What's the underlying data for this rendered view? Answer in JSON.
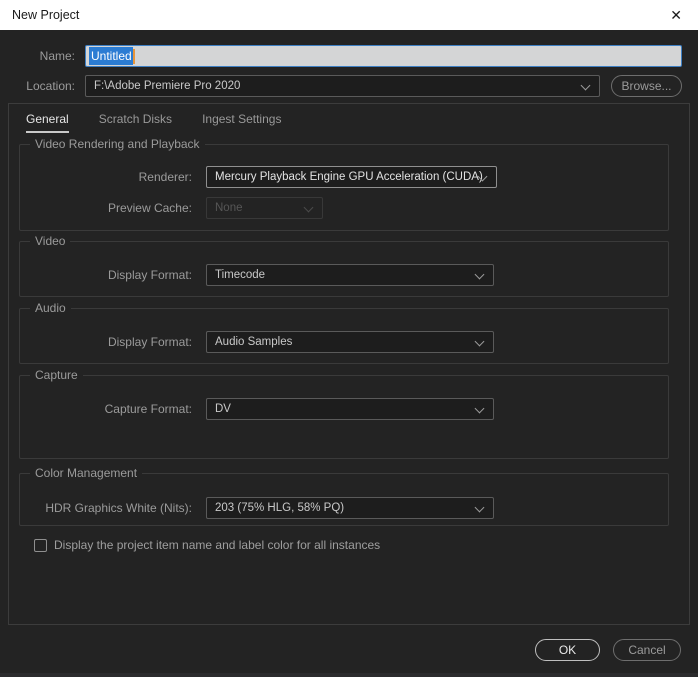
{
  "window": {
    "title": "New Project",
    "close_icon": "✕"
  },
  "fields": {
    "name": {
      "label": "Name:",
      "value": "Untitled"
    },
    "location": {
      "label": "Location:",
      "value": "F:\\Adobe Premiere Pro 2020",
      "browse_label": "Browse..."
    }
  },
  "tabs": [
    {
      "label": "General",
      "active": true
    },
    {
      "label": "Scratch Disks",
      "active": false
    },
    {
      "label": "Ingest Settings",
      "active": false
    }
  ],
  "groups": {
    "video_rendering": {
      "legend": "Video Rendering and Playback",
      "renderer": {
        "label": "Renderer:",
        "value": "Mercury Playback Engine GPU Acceleration (CUDA)"
      },
      "preview_cache": {
        "label": "Preview Cache:",
        "value": "None",
        "disabled": true
      }
    },
    "video": {
      "legend": "Video",
      "display_format": {
        "label": "Display Format:",
        "value": "Timecode"
      }
    },
    "audio": {
      "legend": "Audio",
      "display_format": {
        "label": "Display Format:",
        "value": "Audio Samples"
      }
    },
    "capture": {
      "legend": "Capture",
      "capture_format": {
        "label": "Capture Format:",
        "value": "DV"
      }
    },
    "color_management": {
      "legend": "Color Management",
      "hdr_white": {
        "label": "HDR Graphics White (Nits):",
        "value": "203 (75% HLG, 58% PQ)"
      }
    }
  },
  "checkbox": {
    "label": "Display the project item name and label color for all instances",
    "checked": false
  },
  "buttons": {
    "ok": "OK",
    "cancel": "Cancel"
  },
  "colors": {
    "selection_blue": "#2b7cd3",
    "caret_orange": "#e8953a",
    "focus_border": "#3d7fc4",
    "dialog_bg": "#232323",
    "titlebar_bg": "#ffffff"
  }
}
